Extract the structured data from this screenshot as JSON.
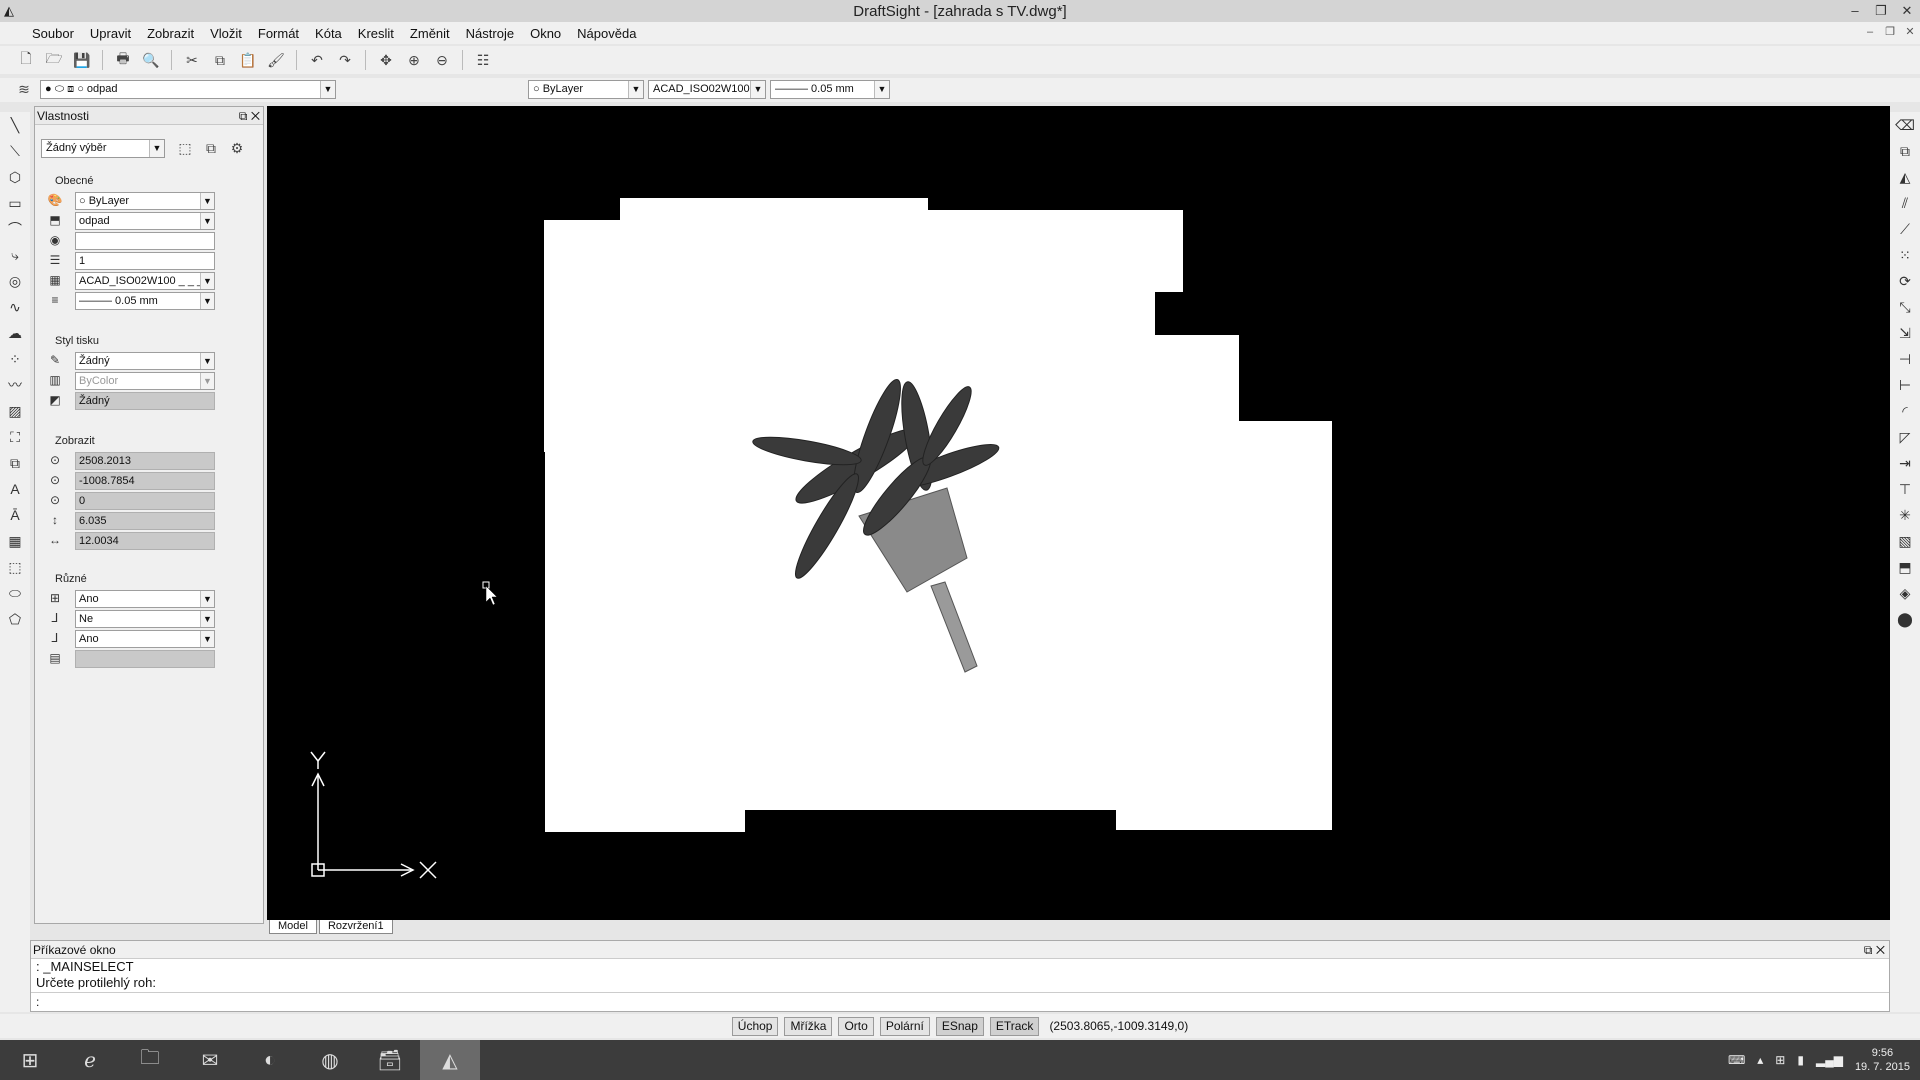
{
  "window": {
    "title": "DraftSight - [zahrada s TV.dwg*]",
    "controls": [
      "minimize-icon",
      "restore-icon",
      "close-icon"
    ]
  },
  "menu": [
    "Soubor",
    "Upravit",
    "Zobrazit",
    "Vložit",
    "Formát",
    "Kóta",
    "Kreslit",
    "Změnit",
    "Nástroje",
    "Okno",
    "Nápověda"
  ],
  "toolbar": {
    "layer": "odpad",
    "color": "ByLayer",
    "linestyle": "ACAD_ISO02W100",
    "lineweight": "——— 0.05 mm"
  },
  "properties": {
    "title": "Vlastnosti",
    "selection": "Žádný výběr",
    "general": {
      "title": "Obecné",
      "color": "ByLayer",
      "layer": "odpad",
      "linetype": "",
      "linescale": "1",
      "linestyle": "ACAD_ISO02W100 _ _ _",
      "lineweight": "——— 0.05 mm"
    },
    "print_style": {
      "title": "Styl tisku",
      "style": "Žádný",
      "table": "ByColor",
      "type": "Žádný"
    },
    "view": {
      "title": "Zobrazit",
      "center_x": "2508.2013",
      "center_y": "-1008.7854",
      "center_z": "0",
      "height": "6.035",
      "width": "12.0034"
    },
    "misc": {
      "title": "Různé",
      "ucs_icon": "Ano",
      "ucs_origin": "Ne",
      "ucs_per_viewport": "Ano",
      "ucs_name": ""
    }
  },
  "canvas": {
    "axis_x": "X",
    "axis_y": "Y"
  },
  "tabs": [
    "Model",
    "Rozvržení1"
  ],
  "command": {
    "title": "Příkazové okno",
    "line1": ": _MAINSELECT",
    "line2": "Určete protilehlý roh:",
    "prompt": ":"
  },
  "status": {
    "buttons": [
      "Úchop",
      "Mřížka",
      "Orto",
      "Polární",
      "ESnap",
      "ETrack"
    ],
    "active": [
      "ESnap",
      "ETrack"
    ],
    "coordinates": "(2503.8065,-1009.3149,0)"
  },
  "taskbar": {
    "time": "9:56",
    "date": "19. 7. 2015"
  }
}
